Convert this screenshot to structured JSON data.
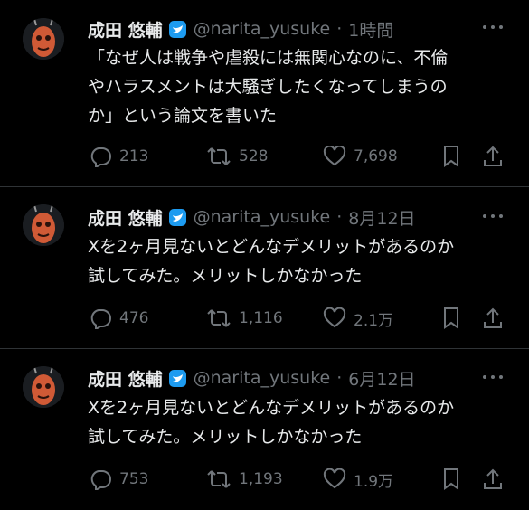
{
  "tweets": [
    {
      "name": "成田 悠輔",
      "handle": "@narita_yusuke",
      "dot": "·",
      "time": "1時間",
      "text": "「なぜ人は戦争や虐殺には無関心なのに、不倫\nやハラスメントは大騒ぎしたくなってしまうの\nか」という論文を書いた",
      "replies": "213",
      "retweets": "528",
      "likes": "7,698"
    },
    {
      "name": "成田 悠輔",
      "handle": "@narita_yusuke",
      "dot": "·",
      "time": "8月12日",
      "text": "Xを2ヶ月見ないとどんなデメリットがあるのか\n試してみた。メリットしかなかった",
      "replies": "476",
      "retweets": "1,116",
      "likes": "2.1万"
    },
    {
      "name": "成田 悠輔",
      "handle": "@narita_yusuke",
      "dot": "·",
      "time": "6月12日",
      "text": "Xを2ヶ月見ないとどんなデメリットがあるのか\n試してみた。メリットしかなかった",
      "replies": "753",
      "retweets": "1,193",
      "likes": "1.9万"
    }
  ],
  "colors": {
    "background": "#000000",
    "text": "#e7e9ea",
    "muted": "#71767b",
    "verified": "#1d9bf0",
    "divider": "#2f3336"
  },
  "icons": [
    "avatar",
    "verified-badge-icon",
    "more-icon",
    "reply-icon",
    "retweet-icon",
    "like-icon",
    "bookmark-icon",
    "share-icon"
  ]
}
